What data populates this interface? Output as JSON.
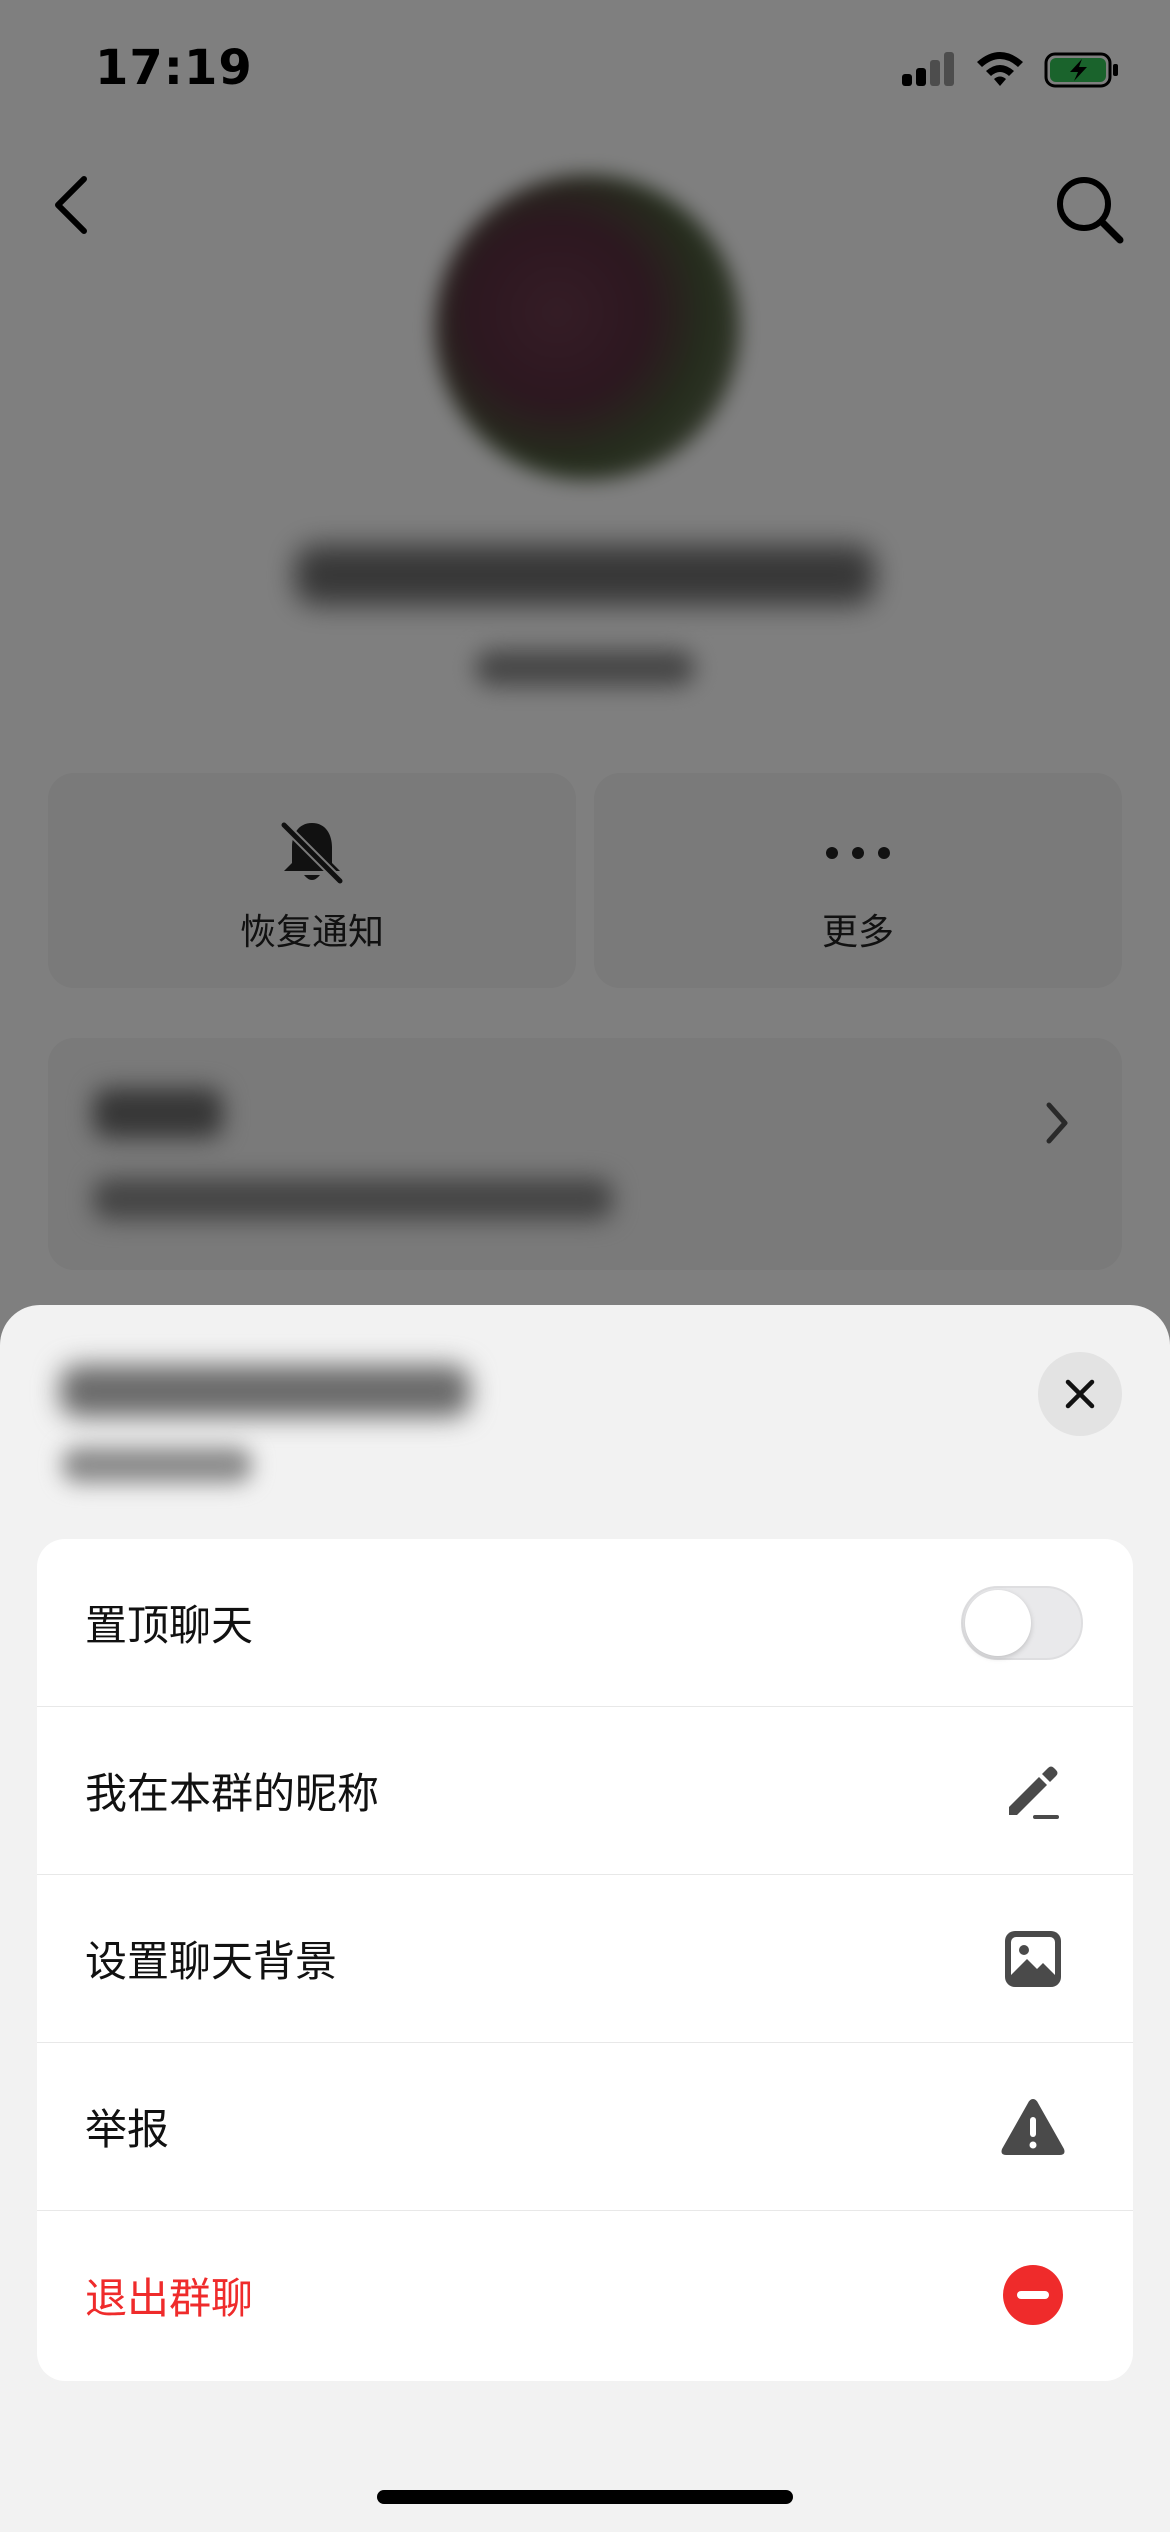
{
  "status_bar": {
    "time": "17:19"
  },
  "background_page": {
    "actions": [
      {
        "label": "恢复通知",
        "icon": "bell-slash-icon"
      },
      {
        "label": "更多",
        "icon": "more-dots-icon"
      }
    ]
  },
  "sheet": {
    "menu": [
      {
        "label": "置顶聊天",
        "control": "toggle",
        "toggle_on": false
      },
      {
        "label": "我在本群的昵称",
        "icon": "edit-pencil-icon"
      },
      {
        "label": "设置聊天背景",
        "icon": "image-icon"
      },
      {
        "label": "举报",
        "icon": "warning-icon"
      },
      {
        "label": "退出群聊",
        "icon": "minus-circle-icon",
        "danger": true
      }
    ]
  },
  "colors": {
    "danger": "#ef2b2b",
    "icon_gray": "#4a4a4a",
    "sheet_bg": "#f2f2f2"
  }
}
